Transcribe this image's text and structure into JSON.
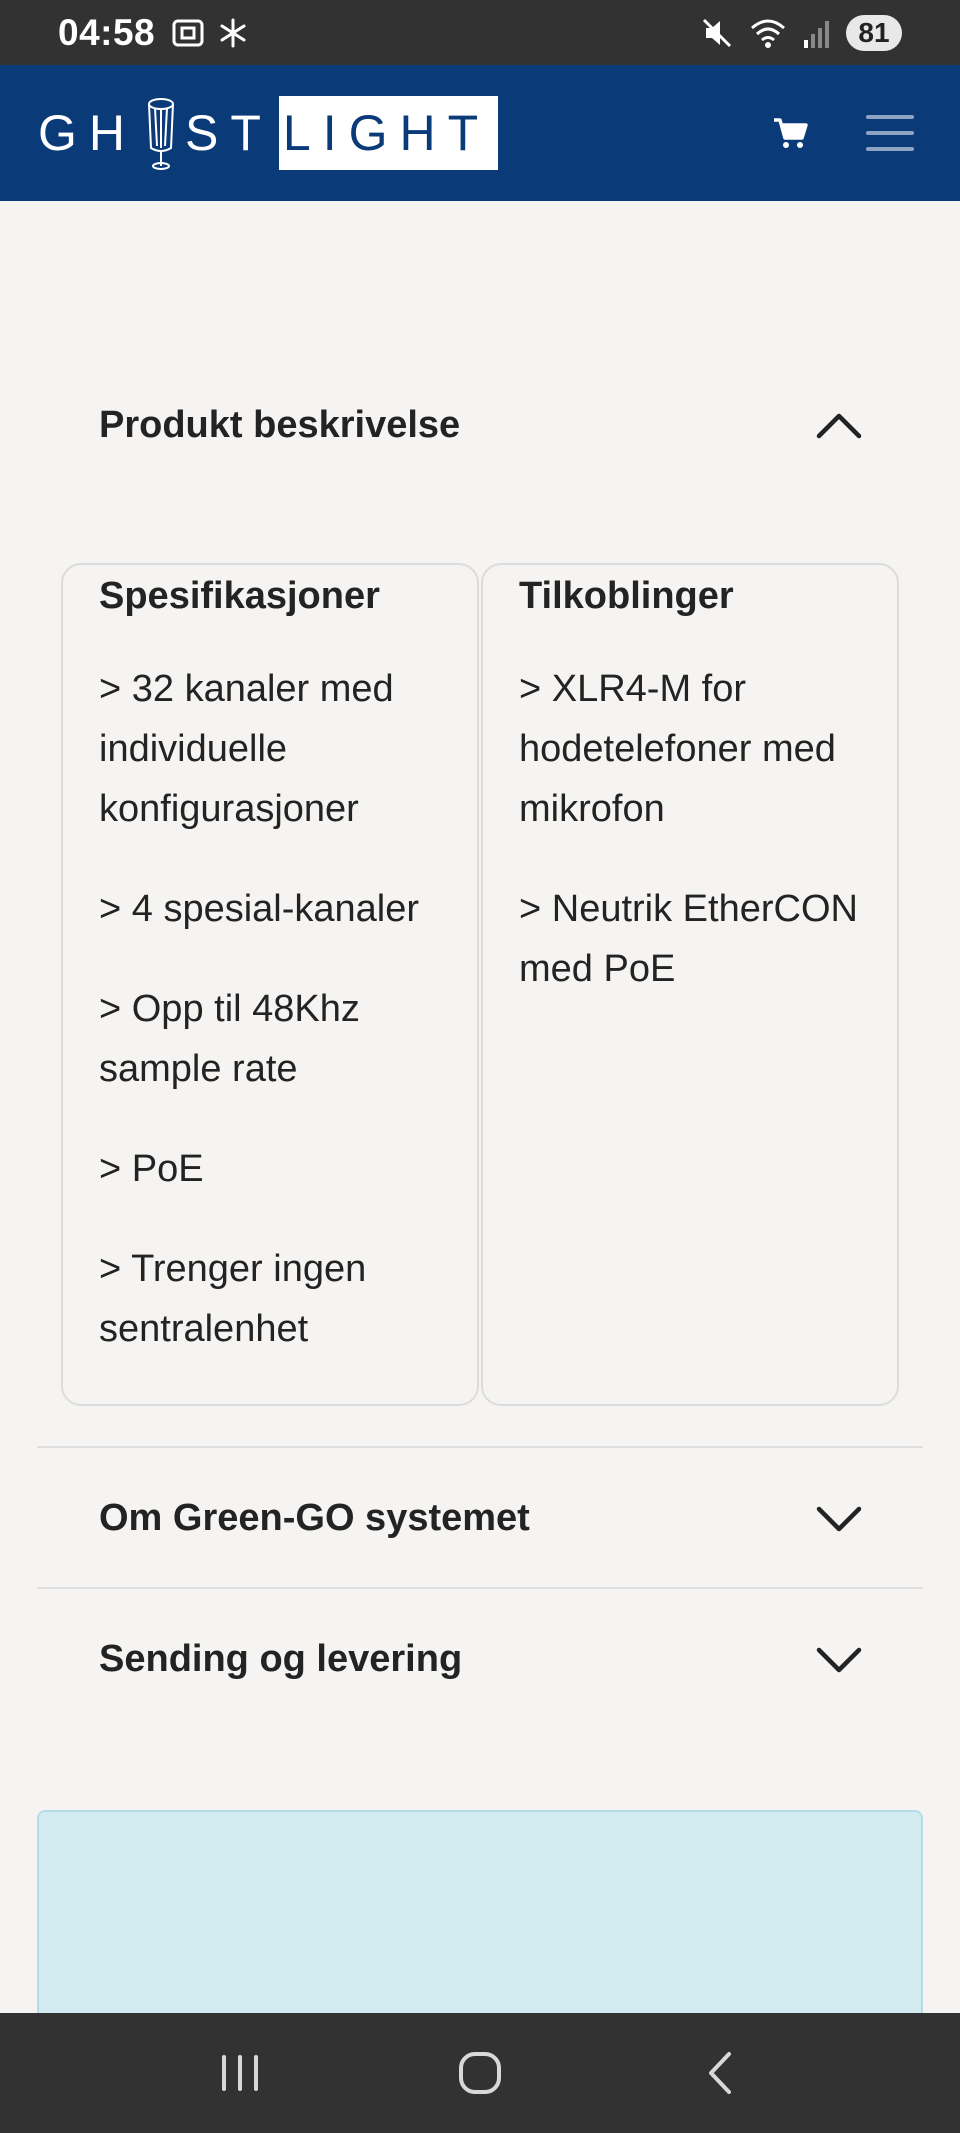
{
  "status_bar": {
    "time": "04:58",
    "battery": "81",
    "icons": [
      "screenshot-icon",
      "snowflake-icon",
      "mute-icon",
      "wifi-icon",
      "signal-icon"
    ]
  },
  "header": {
    "logo_part1": "GH",
    "logo_part2": "ST",
    "logo_part3": "LIGHT",
    "background": "#0a3b78"
  },
  "accordion": {
    "section1": {
      "title": "Produkt beskrivelse",
      "expanded": true
    },
    "section2": {
      "title": "Om Green-GO systemet",
      "expanded": false
    },
    "section3": {
      "title": "Sending og levering",
      "expanded": false
    }
  },
  "specs": {
    "title": "Spesifikasjoner",
    "items": [
      "> 32 kanaler med individuelle konfigurasjoner",
      "> 4 spesial-kanaler",
      "> Opp til 48Khz sample rate",
      "> PoE",
      "> Trenger ingen sentralenhet"
    ]
  },
  "connections": {
    "title": "Tilkoblinger",
    "items": [
      "> XLR4-M for hodetelefoner med mikrofon",
      "> Neutrik EtherCON med PoE"
    ]
  },
  "promo": {
    "background": "#d2ebf0"
  },
  "nav": {
    "icons": [
      "recent-apps-icon",
      "home-icon",
      "back-icon"
    ]
  }
}
